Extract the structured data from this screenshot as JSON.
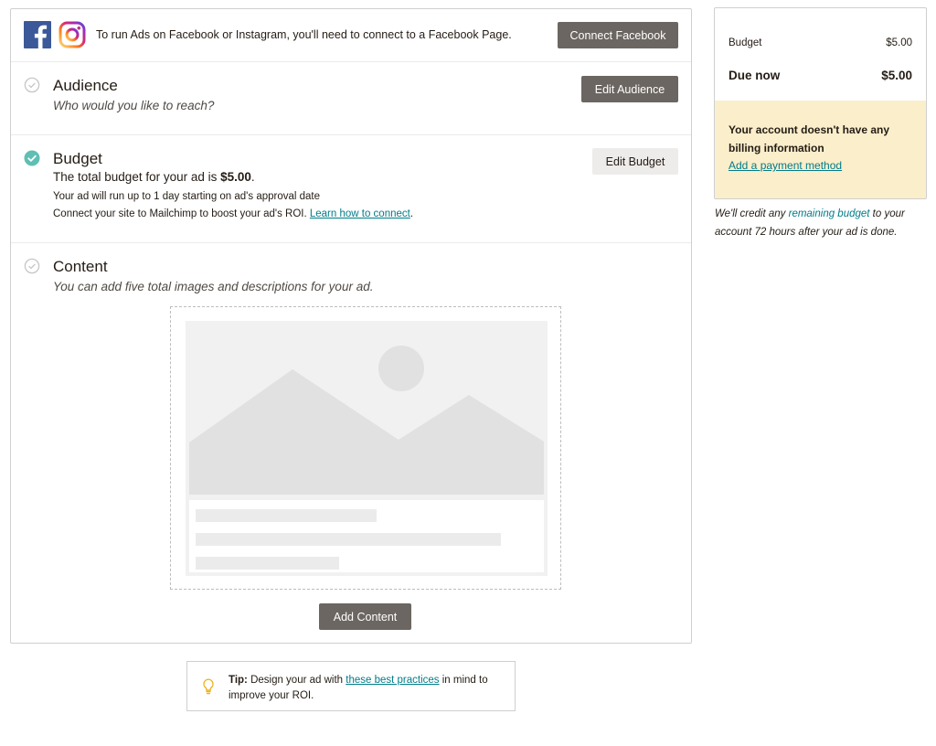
{
  "connect": {
    "message": "To run Ads on Facebook or Instagram, you'll need to connect to a Facebook Page.",
    "button_label": "Connect Facebook"
  },
  "audience": {
    "title": "Audience",
    "subtitle": "Who would you like to reach?",
    "button_label": "Edit Audience",
    "complete": false
  },
  "budget": {
    "title": "Budget",
    "summary_prefix": "The total budget for your ad is ",
    "summary_amount": "$5.00",
    "summary_suffix": ".",
    "duration_text": "Your ad will run up to 1 day starting on ad's approval date",
    "connect_text": "Connect your site to Mailchimp to boost your ad's ROI. ",
    "connect_link": "Learn how to connect",
    "connect_suffix": ".",
    "button_label": "Edit Budget",
    "complete": true
  },
  "content": {
    "title": "Content",
    "subtitle": "You can add five total images and descriptions for your ad.",
    "button_label": "Add Content",
    "complete": false
  },
  "tip": {
    "label": "Tip:",
    "text_before": " Design your ad with ",
    "link": "these best practices",
    "text_after": " in mind to improve your ROI."
  },
  "summary": {
    "budget_label": "Budget",
    "budget_value": "$5.00",
    "due_label": "Due now",
    "due_value": "$5.00",
    "billing_message": "Your account doesn't have any billing information",
    "billing_link": "Add a payment method"
  },
  "credit_note": {
    "before": "We'll credit any ",
    "link": "remaining budget",
    "after": " to your account 72 hours after your ad is done."
  },
  "colors": {
    "button_dark": "#6b6661",
    "button_light": "#eeecea",
    "accent_teal": "#007c89",
    "check_complete": "#5fbfb3",
    "billing_bg": "#fbeecb",
    "tip_icon": "#f2b01e"
  },
  "icons": {
    "facebook": "facebook-logo-icon",
    "instagram": "instagram-logo-icon",
    "check": "check-circle-icon",
    "tip": "lightbulb-icon"
  }
}
